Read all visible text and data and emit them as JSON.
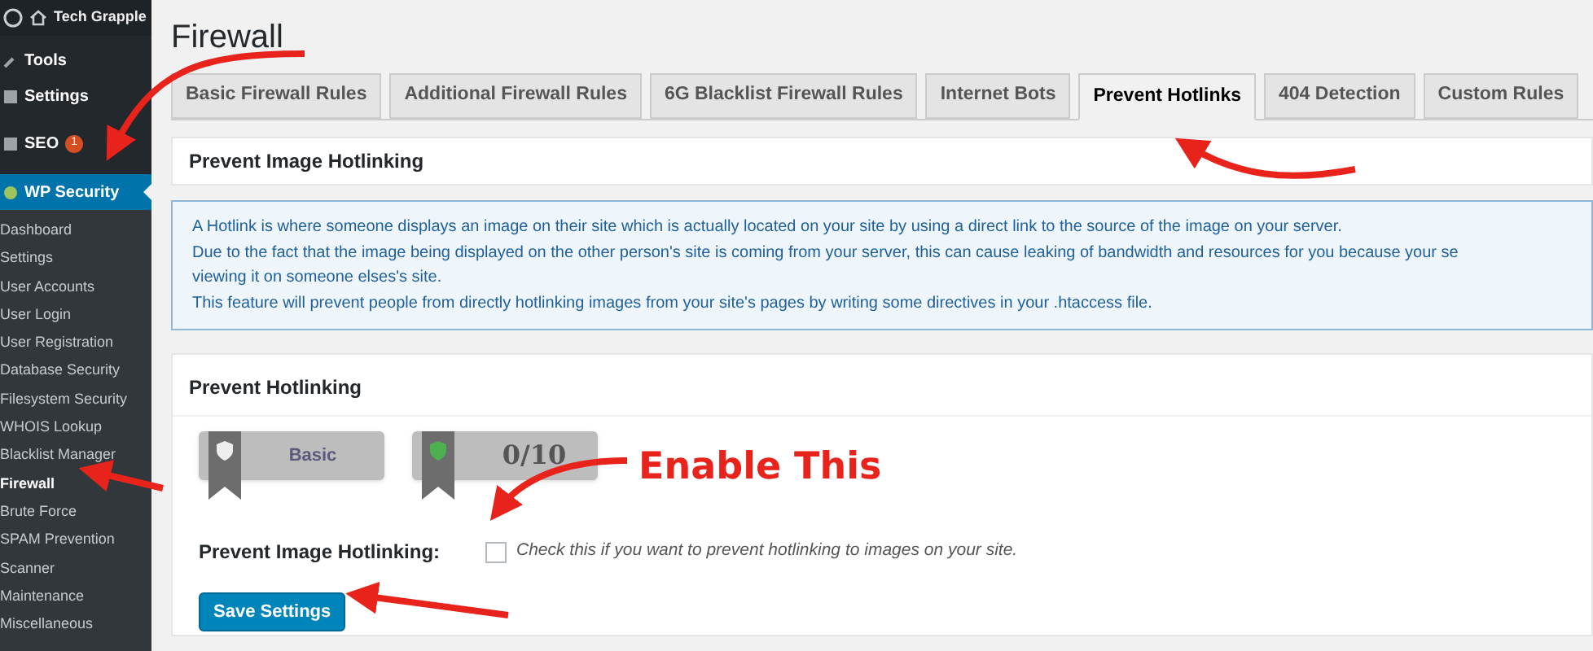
{
  "sidebar": {
    "site": "Tech Grapple",
    "menu": [
      {
        "label": "Tools",
        "kind": "item"
      },
      {
        "label": "Settings",
        "kind": "item"
      },
      {
        "label": "SEO",
        "kind": "item",
        "badge": "1"
      },
      {
        "label": "WP Security",
        "kind": "current"
      }
    ],
    "submenu": [
      {
        "label": "Dashboard",
        "selected": false
      },
      {
        "label": "Settings",
        "selected": false
      },
      {
        "label": "User Accounts",
        "selected": false
      },
      {
        "label": "User Login",
        "selected": false
      },
      {
        "label": "User Registration",
        "selected": false
      },
      {
        "label": "Database Security",
        "selected": false
      },
      {
        "label": "Filesystem Security",
        "selected": false
      },
      {
        "label": "WHOIS Lookup",
        "selected": false
      },
      {
        "label": "Blacklist Manager",
        "selected": false
      },
      {
        "label": "Firewall",
        "selected": true
      },
      {
        "label": "Brute Force",
        "selected": false
      },
      {
        "label": "SPAM Prevention",
        "selected": false
      },
      {
        "label": "Scanner",
        "selected": false
      },
      {
        "label": "Maintenance",
        "selected": false
      },
      {
        "label": "Miscellaneous",
        "selected": false
      }
    ]
  },
  "page": {
    "title": "Firewall",
    "tabs": [
      {
        "label": "Basic Firewall Rules",
        "selected": false
      },
      {
        "label": "Additional Firewall Rules",
        "selected": false
      },
      {
        "label": "6G Blacklist Firewall Rules",
        "selected": false
      },
      {
        "label": "Internet Bots",
        "selected": false
      },
      {
        "label": "Prevent Hotlinks",
        "selected": true
      },
      {
        "label": "404 Detection",
        "selected": false
      },
      {
        "label": "Custom Rules",
        "selected": false
      }
    ],
    "section_title": "Prevent Image Hotlinking",
    "info_lines": [
      "A Hotlink is where someone displays an image on their site which is actually located on your site by using a direct link to the source of the image on your server.",
      "Due to the fact that the image being displayed on the other person's site is coming from your server, this can cause leaking of bandwidth and resources for you because your se",
      "viewing it on someone elses's site.",
      "This feature will prevent people from directly hotlinking images from your site's pages by writing some directives in your .htaccess file."
    ],
    "box": {
      "title": "Prevent Hotlinking",
      "badges": [
        {
          "label": "Basic",
          "kind": "level"
        },
        {
          "label": "0/10",
          "kind": "score"
        }
      ],
      "field": {
        "label": "Prevent Image Hotlinking:",
        "checked": false,
        "description": "Check this if you want to prevent hotlinking to images on your site."
      },
      "button": "Save Settings"
    }
  },
  "annotation": {
    "label": "Enable This"
  }
}
